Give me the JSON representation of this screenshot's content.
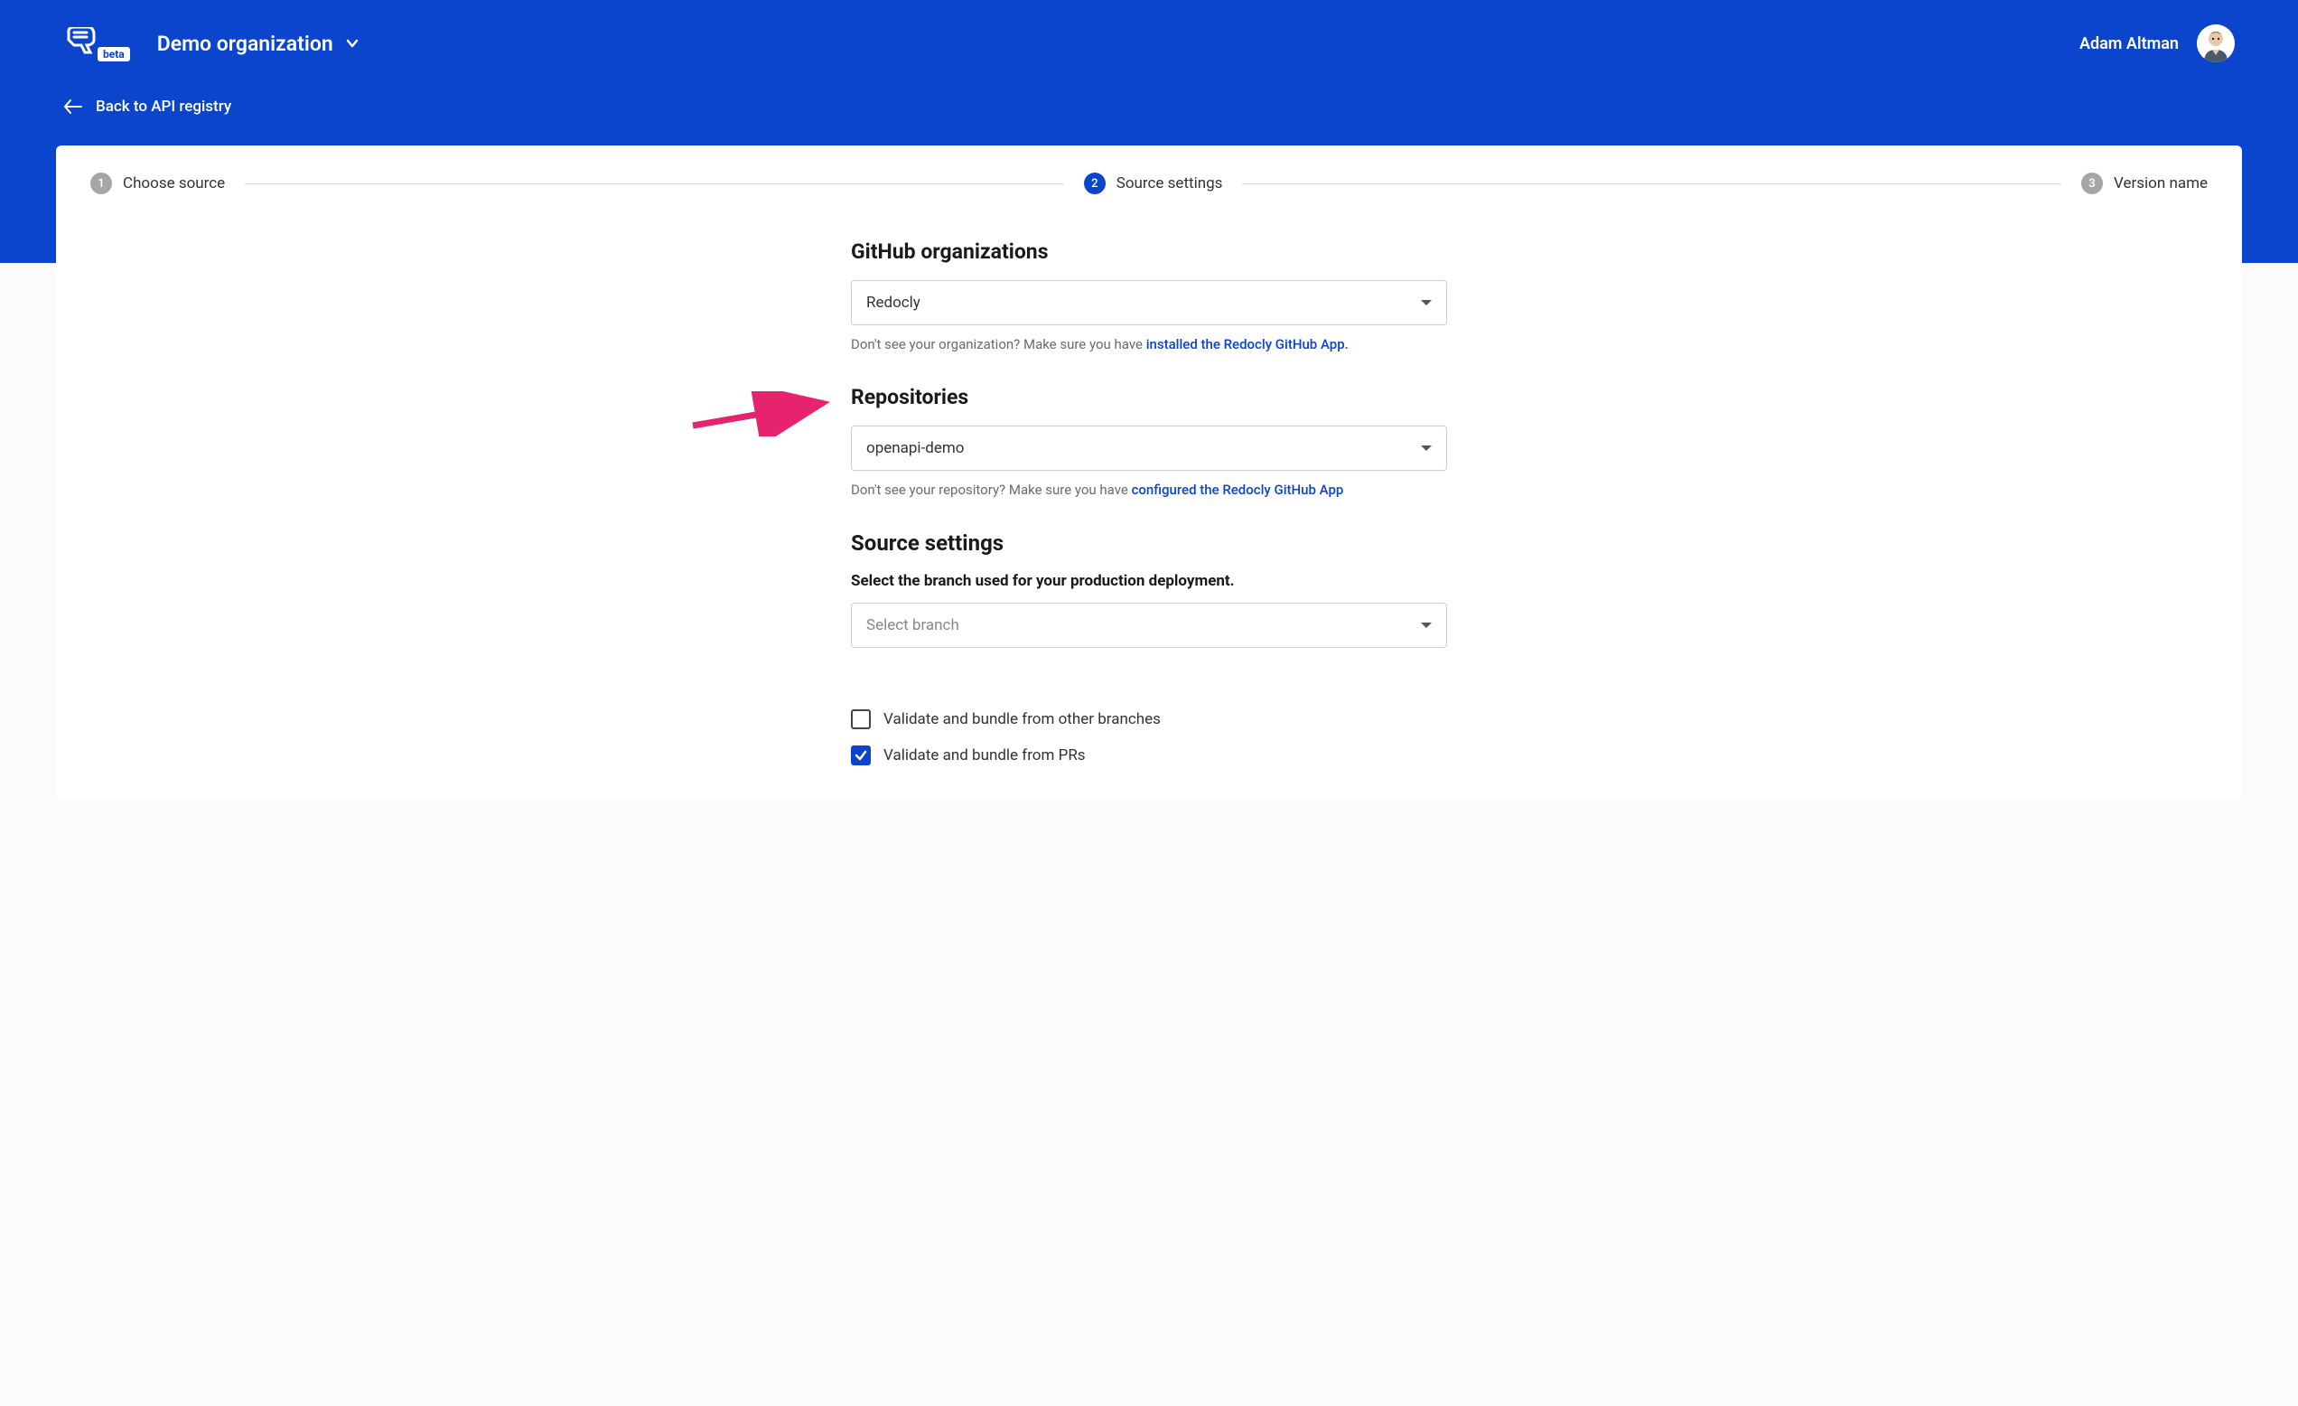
{
  "header": {
    "beta_label": "beta",
    "org_name": "Demo organization",
    "user_name": "Adam Altman",
    "back_label": "Back to API registry"
  },
  "stepper": {
    "steps": [
      {
        "num": "1",
        "label": "Choose source",
        "active": false
      },
      {
        "num": "2",
        "label": "Source settings",
        "active": true
      },
      {
        "num": "3",
        "label": "Version name",
        "active": false
      }
    ]
  },
  "form": {
    "org_section_title": "GitHub organizations",
    "org_selected": "Redocly",
    "org_hint_prefix": "Don't see your organization? Make sure you have ",
    "org_hint_link": "installed the Redocly GitHub App.",
    "repo_section_title": "Repositories",
    "repo_selected": "openapi-demo",
    "repo_hint_prefix": "Don't see your repository? Make sure you have ",
    "repo_hint_link": "configured the Redocly GitHub App",
    "source_settings_title": "Source settings",
    "branch_label": "Select the branch used for your production deployment.",
    "branch_placeholder": "Select branch",
    "checkbox_other_branches": "Validate and bundle from other branches",
    "checkbox_prs": "Validate and bundle from PRs"
  }
}
